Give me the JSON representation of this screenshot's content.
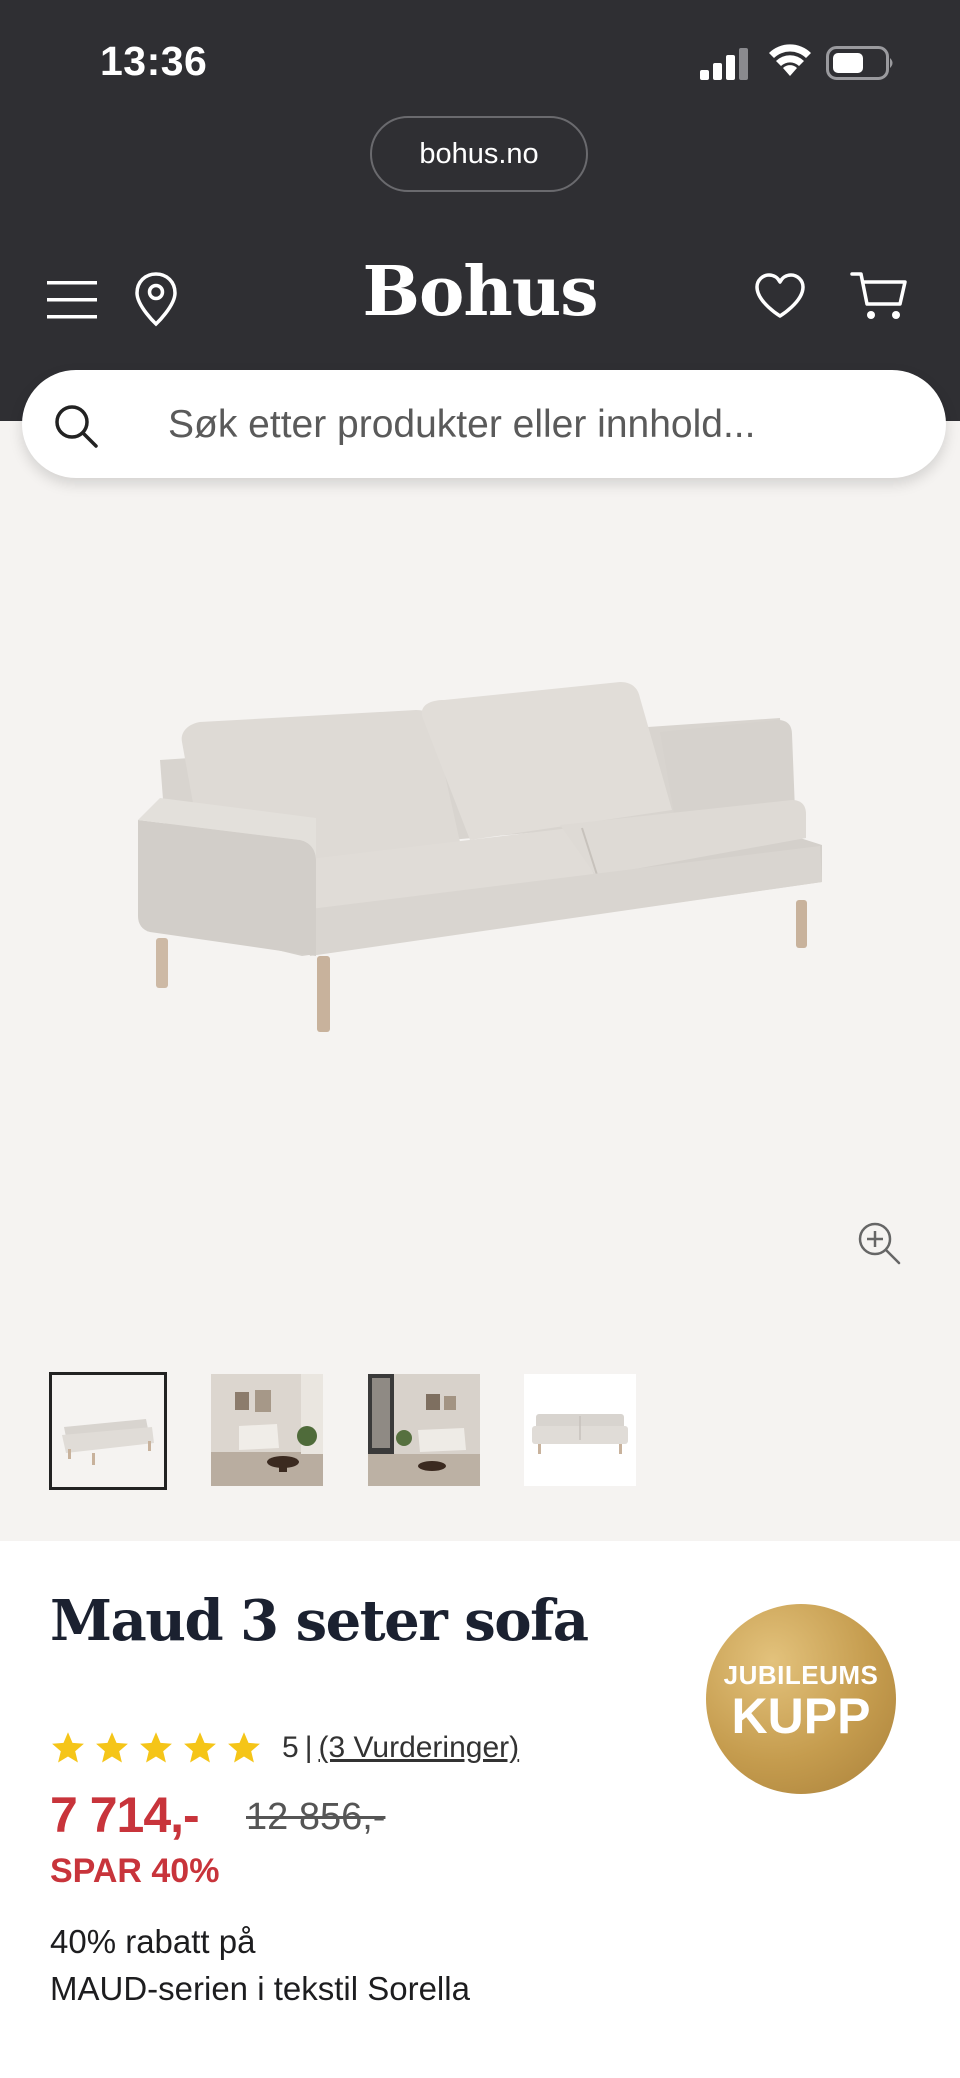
{
  "status_bar": {
    "time": "13:36"
  },
  "browser": {
    "url": "bohus.no"
  },
  "header": {
    "brand": "Bohus"
  },
  "search": {
    "placeholder": "Søk etter produkter eller innhold..."
  },
  "gallery": {
    "thumbnails": [
      "sofa-product-photo",
      "living-room-photo-1",
      "living-room-photo-2",
      "sofa-front-photo"
    ],
    "active_thumbnail": 0
  },
  "product": {
    "title": "Maud 3 seter sofa",
    "rating_value": "5",
    "rating_separator": "|",
    "reviews_link": "(3 Vurderinger)",
    "stars": 5,
    "price": "7 714,-",
    "old_price": "12 856,-",
    "discount": "SPAR 40%",
    "promo_line1": "40% rabatt på",
    "promo_line2": "MAUD-serien i tekstil Sorella",
    "badge_line1": "JUBILEUMS",
    "badge_line2": "KUPP"
  },
  "colors": {
    "header_bg": "#2f2f33",
    "price_red": "#c8343b",
    "star_yellow": "#f5c518",
    "badge_gold": "#c59c4e"
  }
}
